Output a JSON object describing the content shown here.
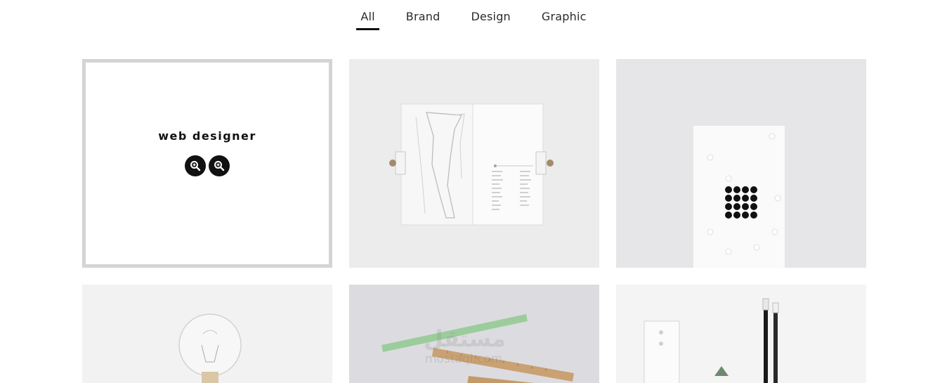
{
  "filters": {
    "tabs": [
      "All",
      "Brand",
      "Design",
      "Graphic"
    ],
    "active": "All"
  },
  "portfolio": {
    "items": [
      {
        "title": "web designer",
        "actions": [
          "zoom-in-icon",
          "zoom-in-icon"
        ],
        "hover": true
      },
      {
        "image": "open-map-booklet"
      },
      {
        "image": "white-card-black-dots"
      },
      {
        "image": "light-bulb"
      },
      {
        "image": "rulers-and-pencil",
        "watermark": "مستقل",
        "watermark_sub": "mostaql.com"
      },
      {
        "image": "pens-and-stationery"
      }
    ]
  },
  "colors": {
    "accent": "#111111",
    "frame": "#d4d4d4",
    "text": "#2b2b2b"
  }
}
